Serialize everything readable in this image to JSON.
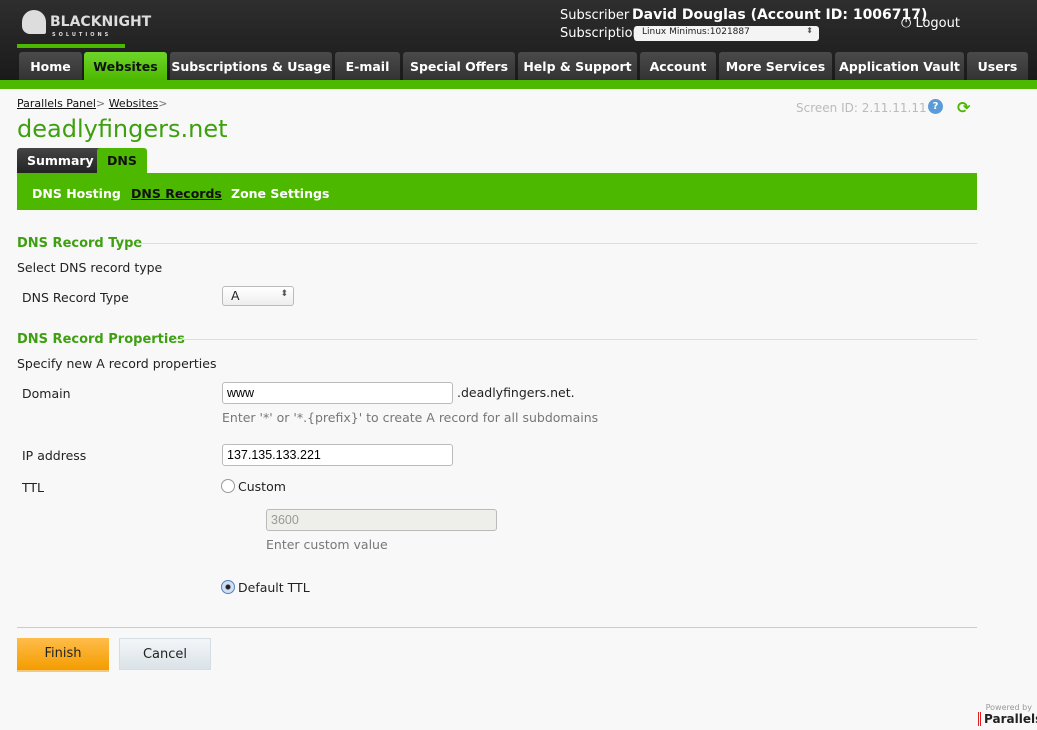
{
  "header": {
    "logo_text": "BLACKNIGHT",
    "logo_sub": "SOLUTIONS",
    "subscriber_label": "Subscriber",
    "subscriber_value": "David Douglas (Account ID: 1006717)",
    "subscription_label": "Subscription",
    "subscription_value": "Linux Minimus:1021887",
    "logout": "Logout"
  },
  "nav": [
    "Home",
    "Websites",
    "Subscriptions & Usage",
    "E-mail",
    "Special Offers",
    "Help & Support",
    "Account",
    "More Services",
    "Application Vault",
    "Users"
  ],
  "nav_active": "Websites",
  "breadcrumb": [
    "Parallels Panel",
    "Websites"
  ],
  "screen_id": "Screen ID:  2.11.11.11",
  "title": "deadlyfingers.net",
  "tabs": [
    "Summary",
    "DNS"
  ],
  "subnav": [
    "DNS Hosting",
    "DNS Records",
    "Zone Settings"
  ],
  "section1": {
    "title": "DNS Record Type",
    "desc": "Select DNS record type",
    "label": "DNS Record Type",
    "value": "A"
  },
  "section2": {
    "title": "DNS Record Properties",
    "desc": "Specify new A record properties",
    "domain_label": "Domain",
    "domain_value": "www",
    "domain_suffix": ".deadlyfingers.net.",
    "domain_hint": "Enter '*' or '*.{prefix}' to create A record for all subdomains",
    "ip_label": "IP address",
    "ip_value": "137.135.133.221",
    "ttl_label": "TTL",
    "ttl_custom": "Custom",
    "ttl_custom_value": "3600",
    "ttl_custom_hint": "Enter custom value",
    "ttl_default": "Default TTL",
    "ttl_selected": "Default TTL"
  },
  "buttons": {
    "finish": "Finish",
    "cancel": "Cancel"
  },
  "footer": {
    "powered": "Powered by",
    "brand": "Parallels"
  }
}
